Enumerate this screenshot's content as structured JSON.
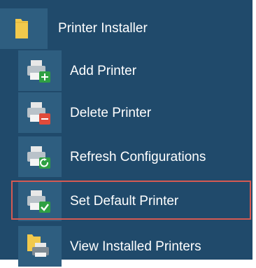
{
  "menu": {
    "header": {
      "label": "Printer Installer",
      "icon": "folder-icon"
    },
    "items": [
      {
        "label": "Add Printer",
        "icon": "add-printer-icon"
      },
      {
        "label": "Delete Printer",
        "icon": "delete-printer-icon"
      },
      {
        "label": "Refresh Configurations",
        "icon": "refresh-printer-icon"
      },
      {
        "label": "Set Default Printer",
        "icon": "default-printer-icon",
        "selected": true
      },
      {
        "label": "View Installed Printers",
        "icon": "view-printers-icon"
      }
    ]
  },
  "colors": {
    "panel_background": "#204a6b",
    "tile_background": "#2e5e80",
    "text": "#ffffff",
    "selection_border": "#d45a52",
    "badge_add": "#2ea043",
    "badge_delete": "#e04a3a",
    "badge_refresh": "#2ea043",
    "badge_default": "#2ea043",
    "folder": "#f2c94c"
  }
}
